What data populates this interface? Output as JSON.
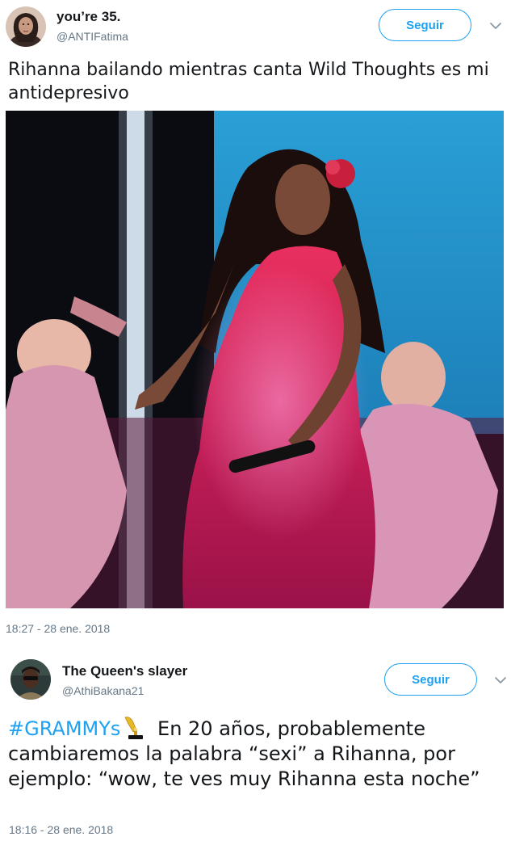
{
  "tweet1": {
    "display_name": "you’re 35.",
    "handle": "@ANTIFatima",
    "follow_label": "Seguir",
    "text": "Rihanna bailando mientras canta Wild Thoughts es mi antidepresivo",
    "timestamp": "18:27 - 28 ene. 2018",
    "media_icon": "photo"
  },
  "tweet2": {
    "display_name": "The Queen's slayer",
    "handle": "@AthiBakana21",
    "follow_label": "Seguir",
    "hashtag": "#GRAMMYs",
    "hashtag_icon": "grammy-gramophone-icon",
    "text": " En 20 años, probablemente cambiaremos la palabra “sexi” a Rihanna, por ejemplo: “wow, te ves muy Rihanna esta noche”",
    "timestamp": "18:16 - 28 ene. 2018"
  },
  "colors": {
    "accent": "#1da1f2",
    "secondary_text": "#657786",
    "primary_text": "#14171a"
  }
}
